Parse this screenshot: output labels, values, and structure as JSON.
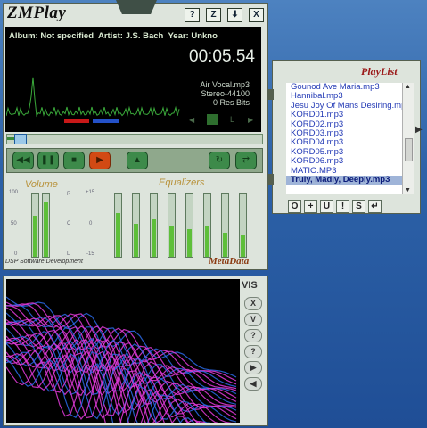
{
  "app": {
    "title": "ZMPlay",
    "titlebar_buttons": [
      "?",
      "Z",
      "⬇",
      "X"
    ]
  },
  "info": {
    "album_label": "Album:",
    "album": "Not specified",
    "artist_label": "Artist:",
    "artist": "J.S. Bach",
    "year_label": "Year:",
    "year": "Unkno"
  },
  "display": {
    "time": "00:05.54",
    "file": "Air Vocal.mp3",
    "format": "Stereo-44100",
    "bits": "0 Res Bits",
    "l_label": "L"
  },
  "seek": {
    "progress": 0.03
  },
  "transport": {
    "icons": [
      "rewind-icon",
      "pause-icon",
      "stop-icon",
      "play-icon",
      "eject-icon",
      "repeat-icon",
      "shuffle-icon"
    ]
  },
  "volume": {
    "label": "Volume",
    "left": 0.68,
    "right": 0.9,
    "scale": [
      "100",
      "50",
      "0"
    ],
    "ch": [
      "R",
      "C",
      "L"
    ]
  },
  "equalizer": {
    "label": "Equalizers",
    "scale": [
      "+15",
      "0",
      "-15"
    ],
    "bands": [
      0.72,
      0.55,
      0.62,
      0.5,
      0.45,
      0.52,
      0.4,
      0.35
    ]
  },
  "footer": {
    "company": "DSP Software Development",
    "brand": "MetaData"
  },
  "playlist": {
    "title": "PlayList",
    "items": [
      "Gounod Ave Maria.mp3",
      "Hannibal.mp3",
      "Jesu Joy Of Mans Desiring.mp3",
      "KORD01.mp3",
      "KORD02.mp3",
      "KORD03.mp3",
      "KORD04.mp3",
      "KORD05.mp3",
      "KORD06.mp3",
      "MATIO.MP3",
      "Truly, Madly, Deeply.mp3"
    ],
    "selected_index": 10,
    "buttons": [
      "O",
      "+",
      "U",
      "!",
      "S",
      "↵"
    ]
  },
  "vis": {
    "label": "VIS",
    "buttons": [
      "X",
      "V",
      "?",
      "?",
      "▶",
      "◀"
    ]
  },
  "colors": {
    "lcd_bg": "#000000",
    "wave": "#3aa83a",
    "vis_magenta": "#e03ad8",
    "vis_blue": "#2a6ae8",
    "accent_red": "#c81818"
  }
}
